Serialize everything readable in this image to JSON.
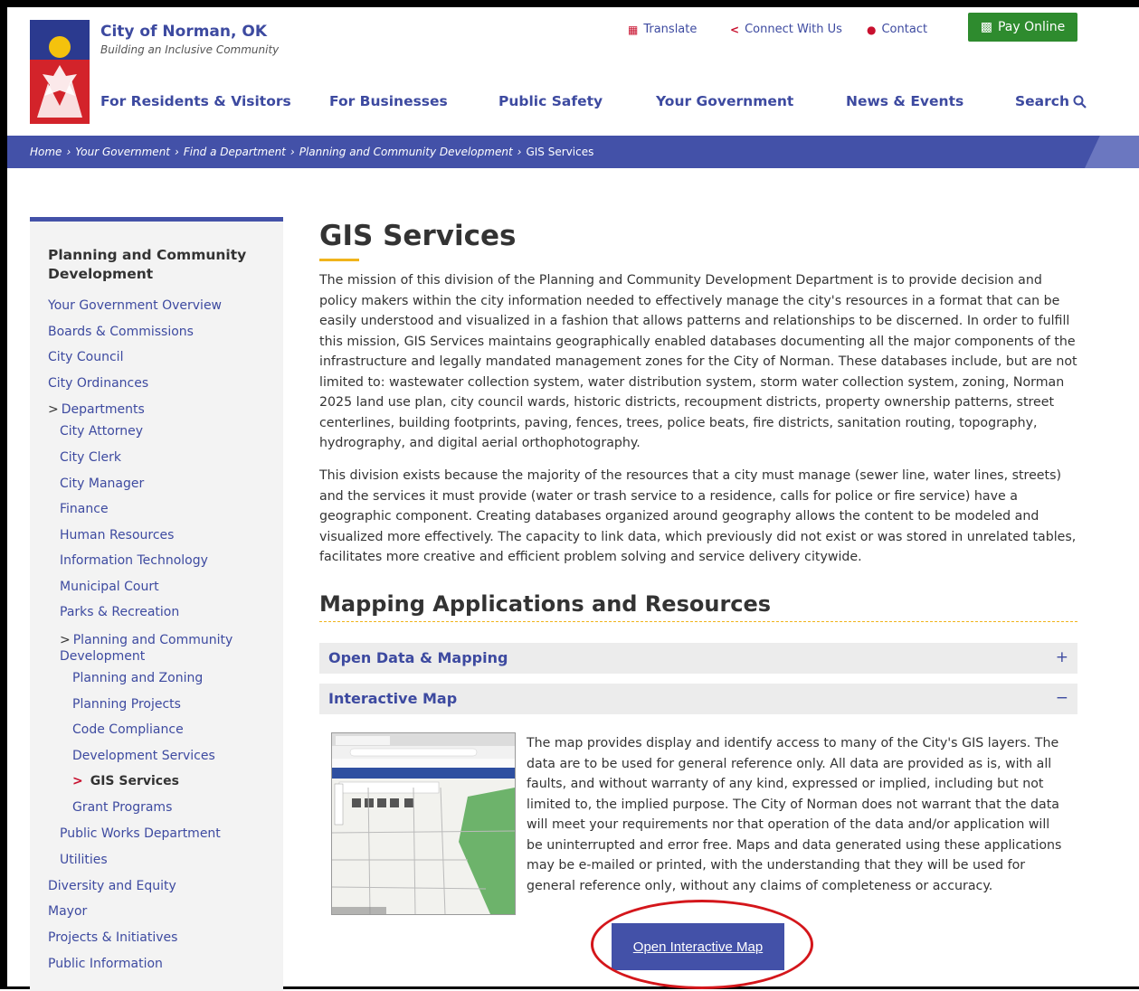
{
  "header": {
    "site_name": "City of Norman, OK",
    "tagline": "Building an Inclusive Community",
    "utility": [
      {
        "label": "Translate",
        "icon": "translate-icon"
      },
      {
        "label": "Connect With Us",
        "icon": "share-icon"
      },
      {
        "label": "Contact",
        "icon": "chat-icon"
      }
    ],
    "pay_label": "Pay Online",
    "nav": [
      "For Residents & Visitors",
      "For Businesses",
      "Public Safety",
      "Your Government",
      "News & Events"
    ],
    "search_label": "Search"
  },
  "breadcrumb": [
    "Home",
    "Your Government",
    "Find a Department",
    "Planning and Community Development",
    "GIS Services"
  ],
  "sidebar": {
    "title": "Planning and Community Development",
    "items": [
      "Your Government Overview",
      "Boards & Commissions",
      "City Council",
      "City Ordinances",
      "Departments",
      "City Attorney",
      "City Clerk",
      "City Manager",
      "Finance",
      "Human Resources",
      "Information Technology",
      "Municipal Court",
      "Parks & Recreation",
      "Planning and Community",
      "Development",
      "Planning and Zoning",
      "Planning Projects",
      "Code Compliance",
      "Development Services",
      "GIS Services",
      "Grant Programs",
      "Public Works Department",
      "Utilities",
      "Diversity and Equity",
      "Mayor",
      "Projects & Initiatives",
      "Public Information"
    ]
  },
  "main": {
    "title": "GIS Services",
    "para1": "The mission of this division of the Planning and Community Development Department is to provide decision and policy makers within the city information needed to effectively manage the city's resources in a format that can be easily understood and visualized in a fashion that allows patterns and relationships to be discerned. In order to fulfill this mission, GIS Services maintains geographically enabled databases documenting all the major components of the infrastructure and legally mandated management zones for the City of Norman. These databases include, but are not limited to: wastewater collection system, water distribution system, storm water collection system, zoning, Norman 2025 land use plan, city council wards, historic districts, recoupment districts, property ownership patterns, street centerlines, building footprints, paving, fences, trees, police beats, fire districts, sanitation routing, topography, hydrography, and digital aerial orthophotography.",
    "para2": "This division exists because the majority of the resources that a city must manage (sewer line, water lines, streets) and the services it must provide (water or trash service to a residence, calls for police or fire service) have a geographic component. Creating databases organized around geography allows the content to be modeled and visualized more effectively. The capacity to link data, which previously did not exist or was stored in unrelated tables, facilitates more creative and efficient problem solving and service delivery citywide.",
    "section_title": "Mapping Applications and Resources",
    "accordion": [
      {
        "label": "Open Data & Mapping",
        "sign": "+"
      },
      {
        "label": "Interactive Map",
        "sign": "−"
      }
    ],
    "map_text": "The map provides display and identify access to many of the City's GIS layers. The data are to be used for general reference only. All data are provided as is, with all faults, and without warranty of any kind, expressed or implied, including but not limited to, the implied purpose. The City of Norman does not warrant that the data will meet your requirements nor that operation of the data and/or application will be uninterrupted and error free. Maps and data generated using these applications may be e-mailed or printed, with the understanding that they will be used for general reference only, without any claims of completeness or accuracy.",
    "open_button": "Open Interactive Map"
  },
  "colors": {
    "brand": "#4351a8",
    "accent": "#f0b41c",
    "pay": "#2e8b2e",
    "annotation": "#d4161b"
  }
}
